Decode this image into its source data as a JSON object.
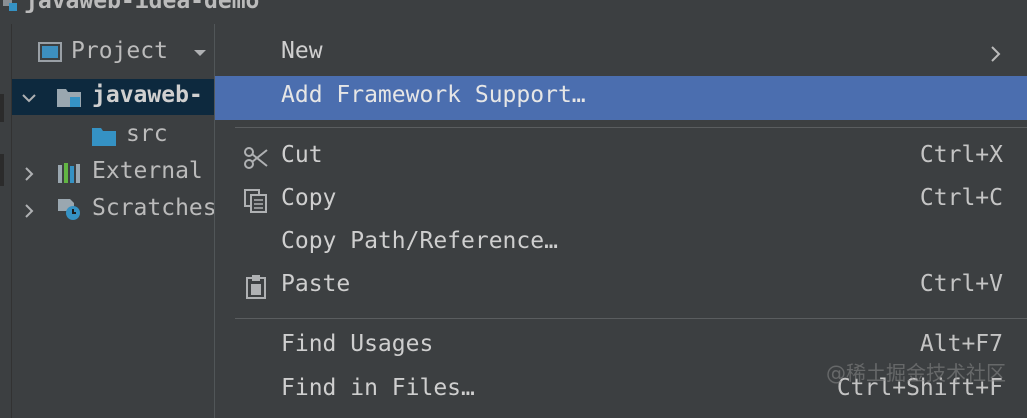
{
  "window": {
    "title": "javaweb-idea-demo"
  },
  "project_panel": {
    "header_label": "Project",
    "tree": [
      {
        "label": "javaweb-",
        "expanded": true,
        "icon": "module-folder-icon"
      },
      {
        "label": "src",
        "icon": "source-folder-icon"
      },
      {
        "label": "External",
        "expanded": false,
        "icon": "libraries-icon"
      },
      {
        "label": "Scratches",
        "expanded": false,
        "icon": "scratches-icon"
      }
    ]
  },
  "context_menu": {
    "items": [
      {
        "label": "New",
        "has_submenu": true
      },
      {
        "label": "Add Framework Support…",
        "highlighted": true
      },
      {
        "label": "Cut",
        "shortcut": "Ctrl+X",
        "icon": "scissors-icon"
      },
      {
        "label": "Copy",
        "shortcut": "Ctrl+C",
        "icon": "copy-icon"
      },
      {
        "label": "Copy Path/Reference…"
      },
      {
        "label": "Paste",
        "shortcut": "Ctrl+V",
        "icon": "clipboard-icon"
      },
      {
        "label": "Find Usages",
        "shortcut": "Alt+F7"
      },
      {
        "label": "Find in Files…",
        "shortcut": "Ctrl+Shift+F"
      }
    ],
    "highlight_color": "#4b6eaf"
  },
  "watermark": "@稀土掘金技术社区"
}
